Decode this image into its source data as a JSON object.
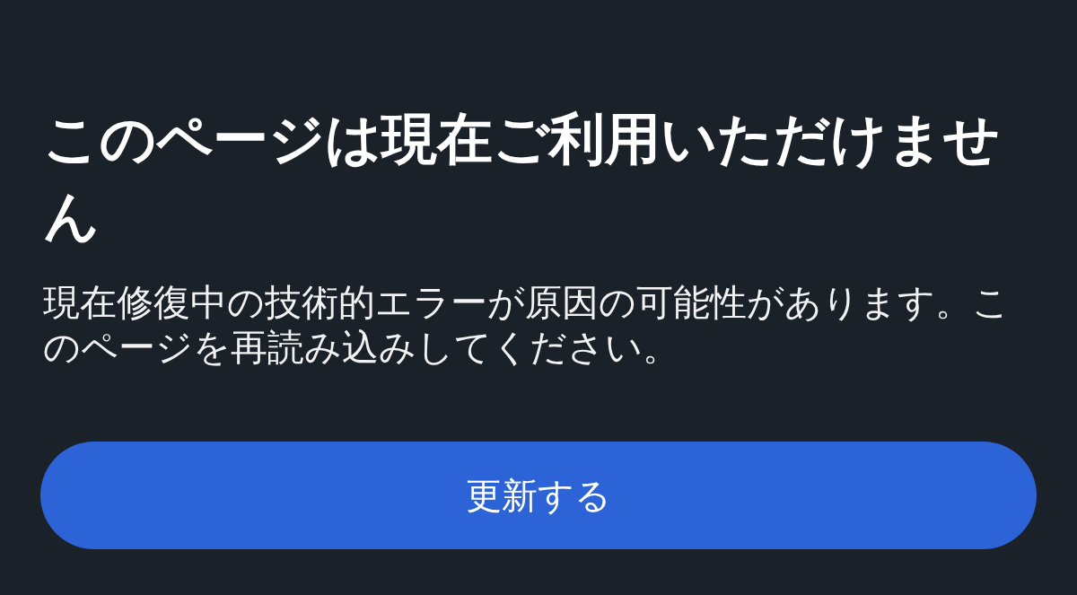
{
  "title": "このページは現在ご利用いただけません",
  "message": "現在修復中の技術的エラーが原因の可能性があります。このページを再読み込みしてください。",
  "buttons": [
    {
      "label": "更新する",
      "kind": "primary"
    }
  ]
}
